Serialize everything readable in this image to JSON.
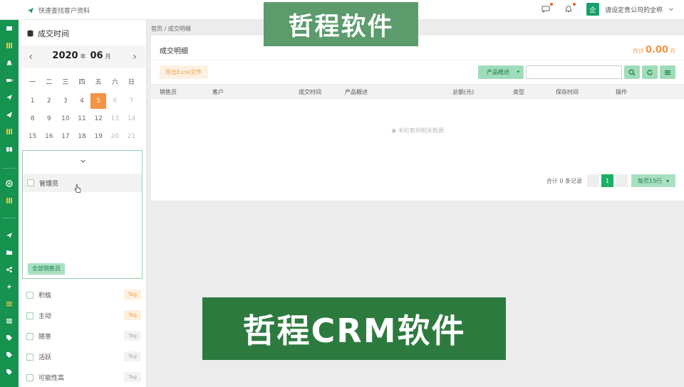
{
  "topbar": {
    "search_link": "快速查找客户资料",
    "company_avatar": "企",
    "company_name": "请设定贵公司的全称"
  },
  "nav": {
    "logo": "Z"
  },
  "calendar": {
    "title": "成交时间",
    "year": "2020",
    "year_unit": "年",
    "month": "06",
    "month_unit": "月",
    "weekdays": [
      "一",
      "二",
      "三",
      "四",
      "五",
      "六",
      "日"
    ],
    "days": [
      "1",
      "2",
      "3",
      "4",
      "5",
      "6",
      "7",
      "8",
      "9",
      "10",
      "11",
      "12",
      "13",
      "14",
      "15",
      "16",
      "17",
      "18",
      "19",
      "20",
      "21"
    ],
    "selected_day": "5"
  },
  "users": {
    "items": [
      {
        "label": "管理员"
      }
    ],
    "all_button": "全部销售员"
  },
  "tags": [
    {
      "label": "积极",
      "badge": "Tag",
      "color": "orange"
    },
    {
      "label": "主动",
      "badge": "Tag",
      "color": "orange"
    },
    {
      "label": "随意",
      "badge": "Tag",
      "color": "gray"
    },
    {
      "label": "活跃",
      "badge": "Tag",
      "color": "gray"
    },
    {
      "label": "可能性高",
      "badge": "Tag",
      "color": "gray"
    }
  ],
  "breadcrumb": "首页 / 成交明细",
  "main": {
    "title": "成交明细",
    "total_prefix": "合计",
    "total_amount": "0.00",
    "total_unit": "元",
    "export_button": "导出Excel文件",
    "product_select": "产品概述",
    "columns": [
      "销售员",
      "客户",
      "成交时间",
      "产品概述",
      "总额(元)",
      "类型",
      "保存时间",
      "操作"
    ],
    "empty_text": "未检索到相关数据",
    "pager": {
      "info": "合计 0 条记录",
      "current_page": "1",
      "per_page": "每页15行"
    }
  },
  "watermarks": {
    "top": "哲程软件",
    "bottom": "哲程CRM软件"
  },
  "colors": {
    "brand_green": "#15934f",
    "accent_orange": "#f39444",
    "light_green": "#9fdcb9"
  }
}
